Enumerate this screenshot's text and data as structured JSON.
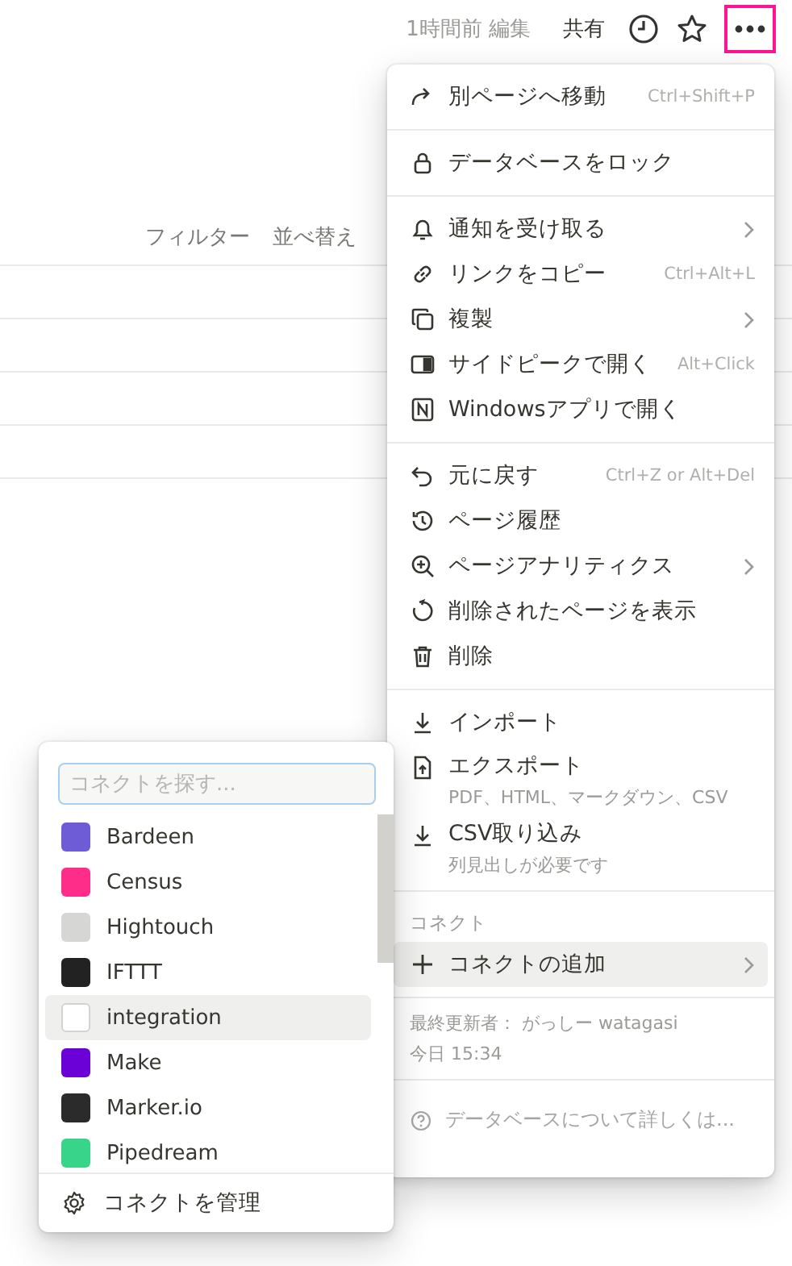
{
  "topbar": {
    "edited": "1時間前 編集",
    "share": "共有"
  },
  "toolbar": {
    "filter": "フィルター",
    "sort": "並べ替え"
  },
  "menu": {
    "sections": [
      {
        "items": [
          {
            "label": "別ページへ移動",
            "shortcut": "Ctrl+Shift+P",
            "submenu": false
          }
        ]
      },
      {
        "items": [
          {
            "label": "データベースをロック",
            "submenu": false
          }
        ]
      },
      {
        "items": [
          {
            "label": "通知を受け取る",
            "submenu": true
          },
          {
            "label": "リンクをコピー",
            "shortcut": "Ctrl+Alt+L",
            "submenu": false
          },
          {
            "label": "複製",
            "submenu": true
          },
          {
            "label": "サイドピークで開く",
            "shortcut": "Alt+Click",
            "submenu": false
          },
          {
            "label": "Windowsアプリで開く",
            "submenu": false
          }
        ]
      },
      {
        "items": [
          {
            "label": "元に戻す",
            "shortcut": "Ctrl+Z or Alt+Del",
            "submenu": false
          },
          {
            "label": "ページ履歴",
            "submenu": false
          },
          {
            "label": "ページアナリティクス",
            "submenu": true
          },
          {
            "label": "削除されたページを表示",
            "submenu": false
          },
          {
            "label": "削除",
            "submenu": false
          }
        ]
      },
      {
        "items": [
          {
            "label": "インポート",
            "submenu": false
          },
          {
            "label": "エクスポート",
            "subtitle": "PDF、HTML、マークダウン、CSV",
            "submenu": false
          },
          {
            "label": "CSV取り込み",
            "subtitle": "列見出しが必要です",
            "submenu": false
          }
        ]
      }
    ],
    "connect": {
      "heading": "コネクト",
      "add": {
        "label": "コネクトの追加",
        "highlighted": true,
        "submenu": true
      }
    },
    "last_edited": {
      "by": "最終更新者： がっしー watagasi",
      "time": "今日 15:34"
    },
    "help": "データベースについて詳しくは..."
  },
  "connections": {
    "search": {
      "placeholder": "コネクトを探す..."
    },
    "items": [
      {
        "name": "Bardeen",
        "selected": false
      },
      {
        "name": "Census",
        "selected": false
      },
      {
        "name": "Hightouch",
        "selected": false
      },
      {
        "name": "IFTTT",
        "selected": false
      },
      {
        "name": "integration",
        "selected": true
      },
      {
        "name": "Make",
        "selected": false
      },
      {
        "name": "Marker.io",
        "selected": false
      },
      {
        "name": "Pipedream",
        "selected": false
      }
    ],
    "manage": "コネクトを管理"
  }
}
